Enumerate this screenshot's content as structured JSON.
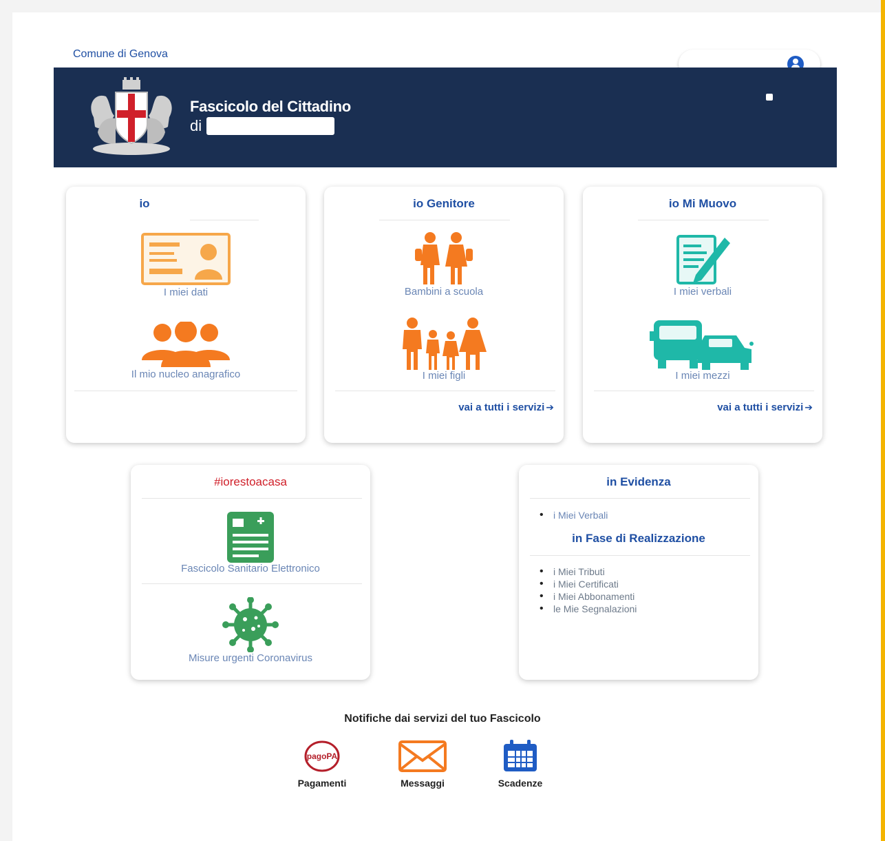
{
  "header": {
    "comune_link": "Comune di Genova",
    "title": "Fascicolo del Cittadino",
    "di_prefix": "di"
  },
  "cards": {
    "io": {
      "title": "io",
      "services": [
        "I miei dati",
        "Il mio nucleo anagrafico"
      ]
    },
    "genitore": {
      "title": "io Genitore",
      "services": [
        "Bambini a scuola",
        "I miei figli"
      ],
      "more": "vai a tutti i servizi"
    },
    "muovo": {
      "title": "io Mi Muovo",
      "services": [
        "I miei verbali",
        "I miei mezzi"
      ],
      "more": "vai a tutti i servizi"
    },
    "casa": {
      "title": "#iorestoacasa",
      "services": [
        "Fascicolo Sanitario Elettronico",
        "Misure urgenti Coronavirus"
      ]
    },
    "evidenza": {
      "title": "in Evidenza",
      "items": [
        "i Miei Verbali"
      ],
      "subtitle": "in Fase di Realizzazione",
      "realizzazione": [
        "i Miei Tributi",
        "i Miei Certificati",
        "i Miei Abbonamenti",
        "le Mie Segnalazioni"
      ]
    }
  },
  "notifiche": {
    "title": "Notifiche dai servizi del tuo Fascicolo",
    "items": [
      "Pagamenti",
      "Messaggi",
      "Scadenze"
    ],
    "pagopa_logo_text": "pagoPA"
  },
  "colors": {
    "header_bg": "#1a2f52",
    "link_blue": "#1f4fa3",
    "orange": "#f47a20",
    "teal": "#1fb8a8",
    "green": "#3a9e5a",
    "red_hashtag": "#d0202a"
  },
  "icons": [
    "user-icon",
    "id-card-icon",
    "family-group-icon",
    "children-school-icon",
    "children-icon",
    "document-pen-icon",
    "vehicles-icon",
    "health-record-icon",
    "virus-icon",
    "pagopa-icon",
    "envelope-icon",
    "calendar-icon",
    "arrow-right-icon"
  ]
}
